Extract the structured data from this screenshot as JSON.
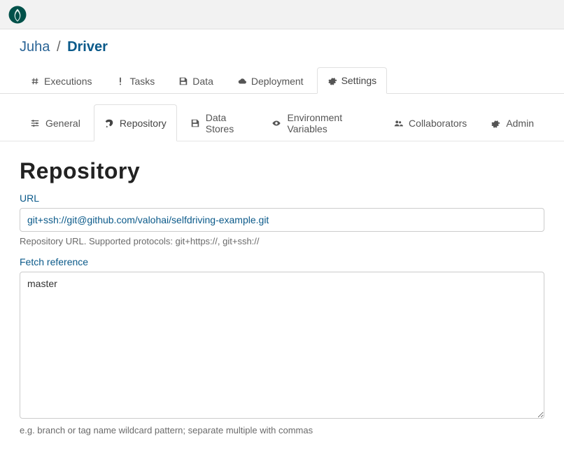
{
  "breadcrumb": {
    "owner": "Juha",
    "project": "Driver"
  },
  "tabs": {
    "executions": "Executions",
    "tasks": "Tasks",
    "data": "Data",
    "deployment": "Deployment",
    "settings": "Settings"
  },
  "subtabs": {
    "general": "General",
    "repository": "Repository",
    "data_stores": "Data Stores",
    "env_vars": "Environment Variables",
    "collaborators": "Collaborators",
    "admin": "Admin"
  },
  "page": {
    "title": "Repository"
  },
  "form": {
    "url_label": "URL",
    "url_value": "git+ssh://git@github.com/valohai/selfdriving-example.git",
    "url_help": "Repository URL. Supported protocols: git+https://, git+ssh://",
    "ref_label": "Fetch reference",
    "ref_value": "master",
    "ref_help": "e.g. branch or tag name wildcard pattern; separate multiple with commas"
  }
}
